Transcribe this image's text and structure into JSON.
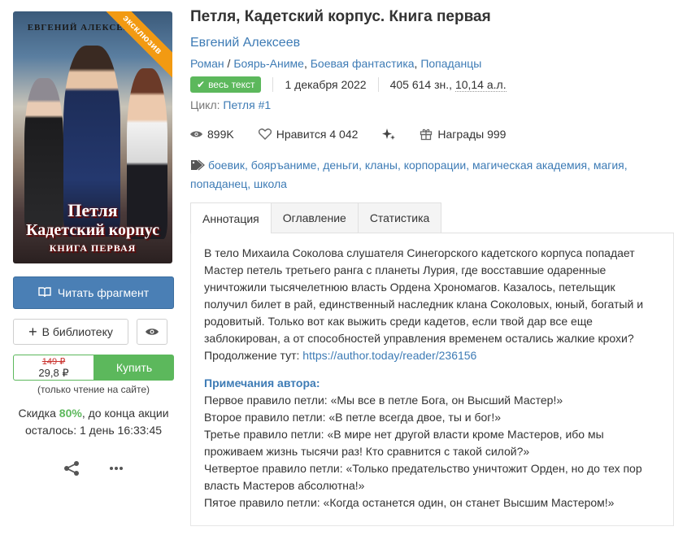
{
  "cover": {
    "author": "ЕВГЕНИЙ АЛЕКСЕЕВ",
    "ribbon": "эксклюзив",
    "title_line1": "Петля",
    "title_line2": "Кадетский корпус",
    "title_line3": "КНИГА ПЕРВАЯ"
  },
  "actions": {
    "read_fragment": "Читать фрагмент",
    "to_library": "В библиотеку",
    "price_old": "149 ₽",
    "price_new": "29,8 ₽",
    "buy": "Купить",
    "only_site": "(только чтение на сайте)",
    "discount_prefix": "Скидка ",
    "discount_value": "80%",
    "discount_suffix": ", до конца акции",
    "time_left": "осталось: 1 день 16:33:45"
  },
  "book": {
    "title": "Петля, Кадетский корпус. Книга первая",
    "author": "Евгений Алексеев",
    "genres": [
      "Роман",
      "Боярь-Аниме",
      "Боевая фантастика",
      "Попаданцы"
    ],
    "genre_first_sep": " / ",
    "status_badge": "весь текст",
    "date": "1 декабря 2022",
    "size": "405 614 зн., ",
    "size_al": "10,14 а.л.",
    "cycle_label": "Цикл: ",
    "cycle_name": "Петля",
    "cycle_num": "#1"
  },
  "stats": {
    "views": "899K",
    "likes": "Нравится 4 042",
    "awards": "Награды 999"
  },
  "tags": [
    "боевик",
    "бояръаниме",
    "деньги",
    "кланы",
    "корпорации",
    "магическая академия",
    "магия",
    "попаданец",
    "школа"
  ],
  "tabs": [
    "Аннотация",
    "Оглавление",
    "Статистика"
  ],
  "annotation": {
    "text": "В тело Михаила Соколова слушателя Синегорского кадетского корпуса попадает Мастер петель третьего ранга с планеты Лурия, где восставшие одаренные уничтожили тысячелетнюю власть Ордена Хрономагов. Казалось, петельщик получил билет в рай, единственный наследник клана Соколовых, юный, богатый и родовитый. Только вот как выжить среди кадетов, если твой дар все еще заблокирован, а от способностей управления временем остались жалкие крохи?",
    "continuation_label": "Продолжение тут: ",
    "continuation_link": "https://author.today/reader/236156",
    "notes_header": "Примечания автора:",
    "notes": [
      "Первое правило петли: «Мы все в петле Бога, он Высший Мастер!»",
      "Второе правило петли: «В петле всегда двое, ты и бог!»",
      "Третье правило петли: «В мире нет другой власти кроме Мастеров, ибо мы проживаем жизнь тысячи раз! Кто сравнится с такой силой?»",
      "Четвертое правило петли: «Только предательство уничтожит Орден, но до тех пор власть Мастеров абсолютна!»",
      "Пятое правило петли: «Когда останется один, он станет Высшим Мастером!»"
    ]
  },
  "colors": {
    "link": "#3d7bb5",
    "read_button": "#4a7fb5",
    "green": "#5cb85c",
    "ribbon": "#f29a12"
  }
}
